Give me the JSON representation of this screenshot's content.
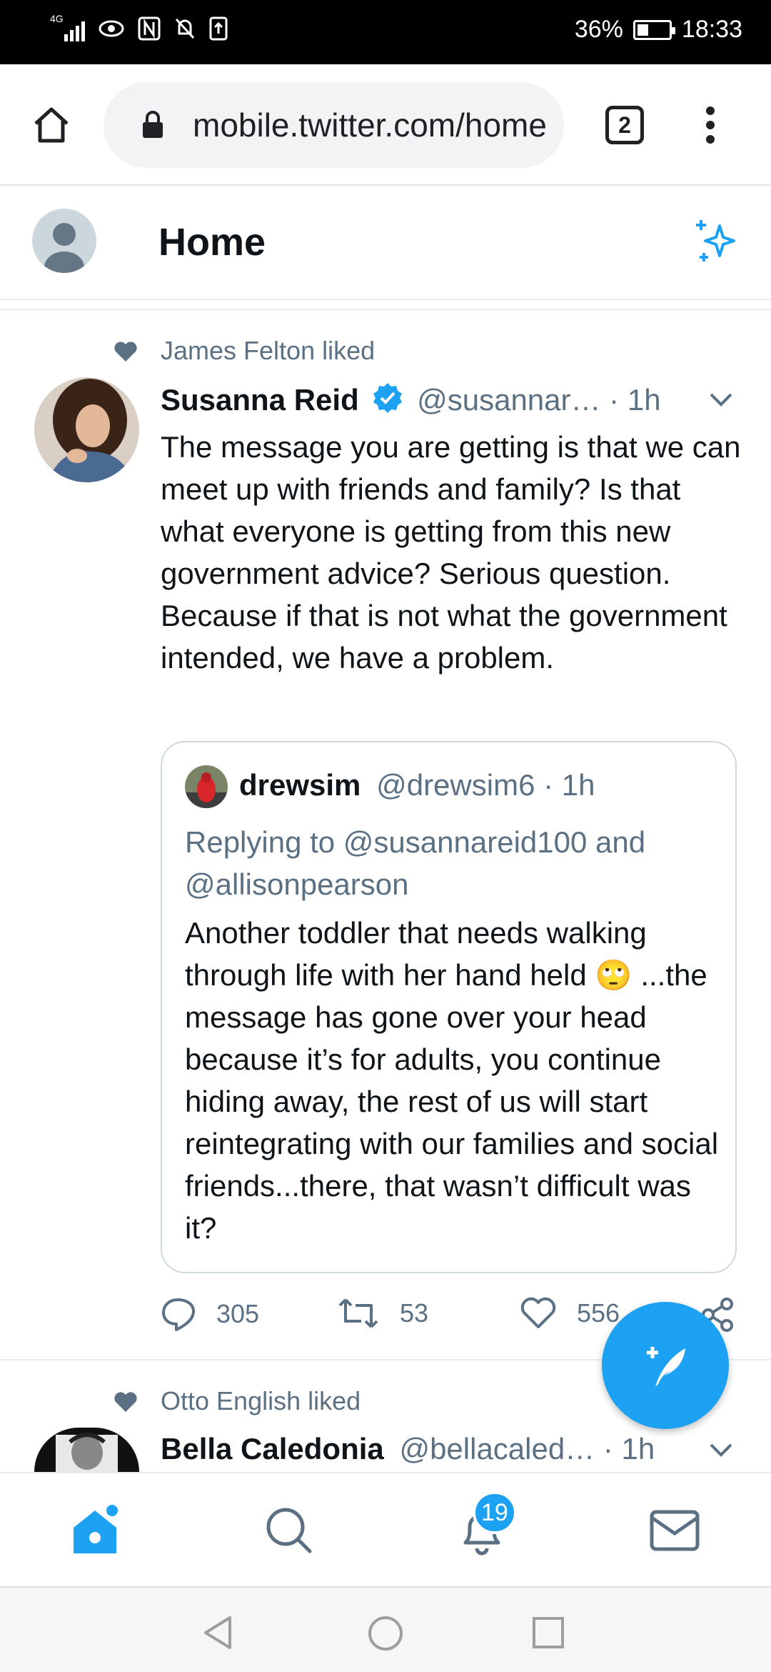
{
  "status_bar": {
    "network": "4G",
    "battery": "36%",
    "battery_level": 0.36,
    "time": "18:33"
  },
  "browser": {
    "url": "mobile.twitter.com/home",
    "tab_count": "2"
  },
  "header": {
    "title": "Home"
  },
  "tweets": [
    {
      "social_context": "James Felton liked",
      "author_name": "Susanna Reid",
      "verified": true,
      "handle_time": "@susannar… · 1h",
      "text": "The message you are getting is that we can meet up with friends and family? Is that what everyone is getting from this new government advice? Serious question. Because if that is not what the government intended, we have a problem.",
      "quote": {
        "author_name": "drewsim",
        "handle_time": "@drewsim6 · 1h",
        "replying_to": "Replying to @susannareid100 and @allisonpearson",
        "text": "Another toddler that needs walking through life with her hand held 🙄 ...the message has gone over your head because it’s for adults, you continue hiding away, the rest of us will start reintegrating with our families and social friends...there, that wasn’t difficult was it?"
      },
      "replies": "305",
      "retweets": "53",
      "likes": "556"
    },
    {
      "social_context": "Otto English liked",
      "author_name": "Bella Caledonia",
      "handle_time": "@bellacaled… · 1h"
    }
  ],
  "bottom_nav": {
    "notifications_badge": "19"
  },
  "colors": {
    "brand": "#1da1f2",
    "secondary_text": "#5b7083",
    "verified": "#1da1f2"
  },
  "icons": [
    "home-icon",
    "lock-icon",
    "more-vert-icon",
    "sparkle-icon",
    "heart-icon",
    "verified-icon",
    "chevron-down-icon",
    "reply-icon",
    "retweet-icon",
    "like-icon",
    "share-icon",
    "compose-tweet-icon",
    "search-icon",
    "bell-icon",
    "mail-icon",
    "back-icon",
    "circle-home-icon",
    "recents-icon"
  ]
}
